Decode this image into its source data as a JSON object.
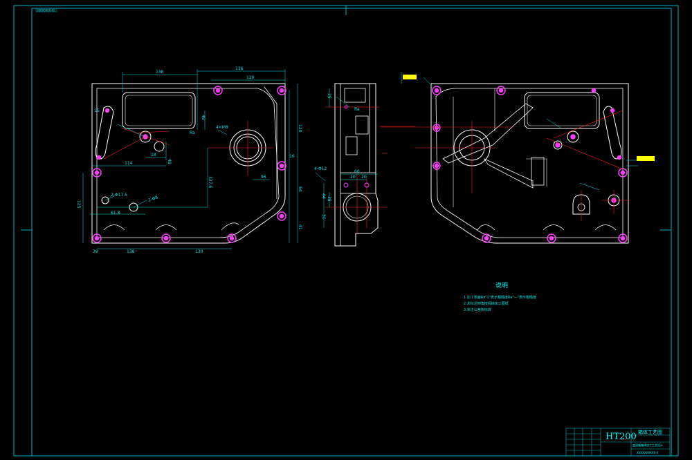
{
  "drawing": {
    "corner_tag": "00000000-00",
    "colors": {
      "background": "#000000",
      "border": "#00b4c8",
      "outline": "#ffffff",
      "dimension": "#00e5e5",
      "hole": "#ff3cff",
      "center_line": "#ff2020",
      "tag_fill": "#ffff00"
    }
  },
  "front_view": {
    "dims": {
      "d138_top": "138",
      "d136_top": "136",
      "d120_top": "120",
      "d15_left": "15",
      "d114": "114",
      "d48": "48",
      "d18": "18",
      "d48b": "48",
      "d327": "327.6",
      "d96": "96",
      "d125": "125",
      "d120_right": "120",
      "d64": "64",
      "d41": "41",
      "d138_bottom": "138",
      "d130_bottom": "130",
      "d39": "39",
      "d618": "61.8",
      "d16": "16"
    },
    "callouts": {
      "hole_a": "2-Φ17.5",
      "hole_b": "2-Φ8",
      "thread": "4×M8",
      "rough": "Ra"
    }
  },
  "side_view": {
    "dims": {
      "d25": "25",
      "d60": "60",
      "d20a": "20",
      "d20b": "20",
      "d44": "44",
      "d31": "31",
      "d38": "38"
    },
    "callouts": {
      "c1": "4-Φ12",
      "c2": "Ra"
    }
  },
  "notes": {
    "heading": "说明",
    "lines": [
      "1.加工表面Ra\"1\"表示粗糙度Ra\"—\"表示粗糙度",
      "2.未标注倒角按机械加工图纸",
      "3.未注公差按标准"
    ]
  },
  "title_block": {
    "material": "HT200",
    "name": "箱体工艺图",
    "subtitle": "变速箱箱体加工工艺设计",
    "drawing_no": "XXXXXXXXXX-X"
  }
}
